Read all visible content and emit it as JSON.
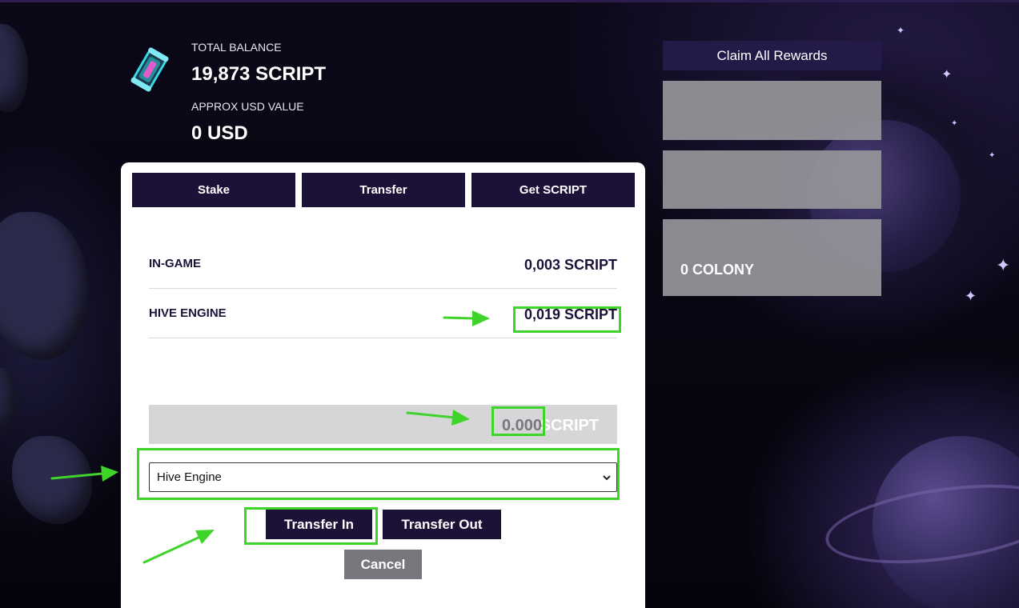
{
  "balance": {
    "total_label": "TOTAL BALANCE",
    "total_value": "19,873 SCRIPT",
    "usd_label": "APPROX USD VALUE",
    "usd_value": "0 USD",
    "icon": "token-canister-icon"
  },
  "rewards": {
    "claim_label": "Claim All Rewards",
    "colony_value": "0 COLONY"
  },
  "modal": {
    "tabs": [
      "Stake",
      "Transfer",
      "Get SCRIPT"
    ],
    "rows": [
      {
        "label": "IN-GAME",
        "amount": "0,003 SCRIPT"
      },
      {
        "label": "HIVE ENGINE",
        "amount": "0,019 SCRIPT"
      }
    ],
    "amount_input": "0.000",
    "amount_unit": "SCRIPT",
    "destination": {
      "selected": "Hive Engine",
      "icon": "chevron-down-icon"
    },
    "buttons": {
      "transfer_in": "Transfer In",
      "transfer_out": "Transfer Out",
      "cancel": "Cancel"
    }
  },
  "colors": {
    "accent_dark": "#1c1238",
    "highlight_green": "#3fd42a",
    "cancel_gray": "#77787d"
  }
}
